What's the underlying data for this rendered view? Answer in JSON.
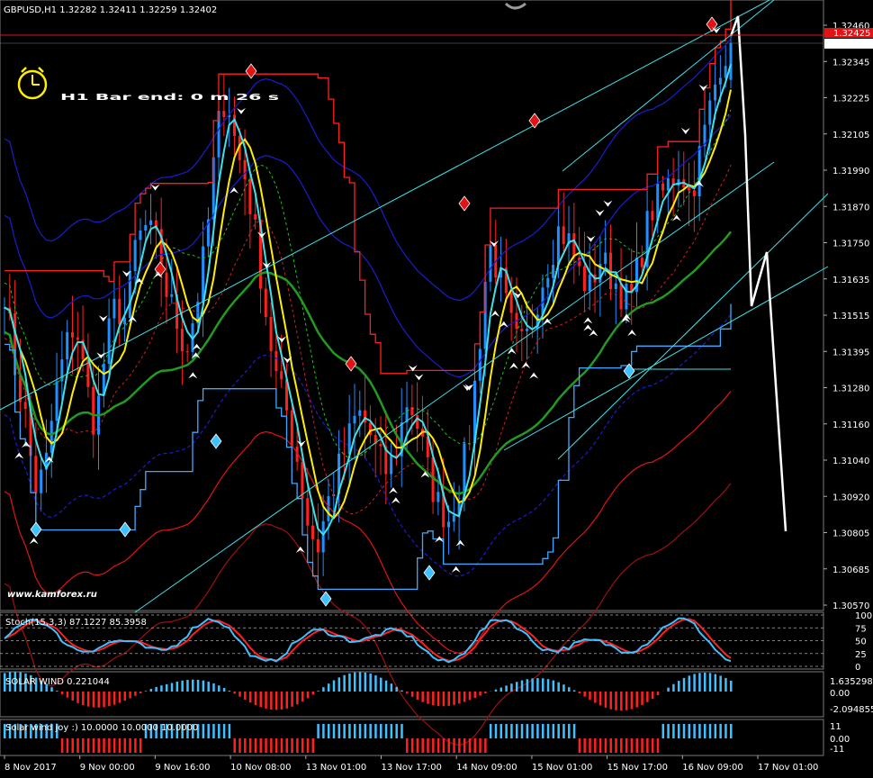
{
  "header": {
    "symbol_line": "GBPUSD,H1  1.32282 1.32411 1.32259 1.32402"
  },
  "timer": {
    "text": "H1 Bar end: 0 m 26 s",
    "icon": "alarm-clock-icon"
  },
  "watermark": "www.kamforex.ru",
  "colors": {
    "background": "#000000",
    "bull": "#1e90ff",
    "bear": "#ff2020",
    "channel_cyan": "#40e0e8",
    "envelope_blue": "#1c1cd0",
    "envelope_red": "#e01414",
    "green_ma": "#229a22",
    "yellow_line": "#ffee00",
    "bid_line": "#e01414",
    "timer_text": "#ffff00"
  },
  "price_axis": {
    "labels": [
      "1.32460",
      "1.32345",
      "1.32225",
      "1.32105",
      "1.31990",
      "1.31870",
      "1.31750",
      "1.31635",
      "1.31515",
      "1.31395",
      "1.31280",
      "1.31160",
      "1.31040",
      "1.30920",
      "1.30805",
      "1.30685",
      "1.30570"
    ],
    "current_price_box": "1.32402",
    "ask_price_box": "1.32425"
  },
  "time_axis": {
    "labels": [
      "8 Nov 2017",
      "9 Nov 00:00",
      "9 Nov 16:00",
      "10 Nov 08:00",
      "13 Nov 01:00",
      "13 Nov 17:00",
      "14 Nov 09:00",
      "15 Nov 01:00",
      "15 Nov 17:00",
      "16 Nov 09:00",
      "17 Nov 01:00"
    ]
  },
  "stoch": {
    "label": "Stoch(15,3,3) 87.1227 85.3958",
    "levels": [
      "100",
      "75",
      "50",
      "25",
      "0"
    ]
  },
  "solar_wind": {
    "label": "SOLAR WIND 0.221044",
    "levels": [
      "1.635298",
      "0.00",
      "-2.094855"
    ]
  },
  "solar_wind_joy": {
    "label": "Solar wind joy :) 10.0000 10.0000 10.0000",
    "levels": [
      "11",
      "0.00",
      "-11"
    ]
  },
  "chart_data": {
    "type": "candlestick",
    "symbol": "GBPUSD",
    "timeframe": "H1",
    "ohlc_last": {
      "open": 1.32282,
      "high": 1.32411,
      "low": 1.32259,
      "close": 1.32402
    },
    "ylim": [
      1.3057,
      1.3246
    ],
    "close_series_approx": [
      1.316,
      1.3135,
      1.312,
      1.3095,
      1.31,
      1.3125,
      1.314,
      1.315,
      1.313,
      1.3115,
      1.314,
      1.3155,
      1.315,
      1.3175,
      1.318,
      1.3175,
      1.316,
      1.315,
      1.314,
      1.3155,
      1.3175,
      1.321,
      1.3225,
      1.3205,
      1.3195,
      1.3175,
      1.315,
      1.313,
      1.312,
      1.3105,
      1.3085,
      1.3075,
      1.309,
      1.31,
      1.311,
      1.312,
      1.3115,
      1.3105,
      1.31,
      1.311,
      1.3125,
      1.3115,
      1.31,
      1.309,
      1.3085,
      1.3095,
      1.311,
      1.314,
      1.3175,
      1.3165,
      1.315,
      1.314,
      1.3145,
      1.316,
      1.317,
      1.318,
      1.3175,
      1.3165,
      1.316,
      1.317,
      1.3165,
      1.316,
      1.3155,
      1.317,
      1.3185,
      1.319,
      1.3195,
      1.32,
      1.319,
      1.3205,
      1.322,
      1.3235,
      1.324
    ]
  }
}
